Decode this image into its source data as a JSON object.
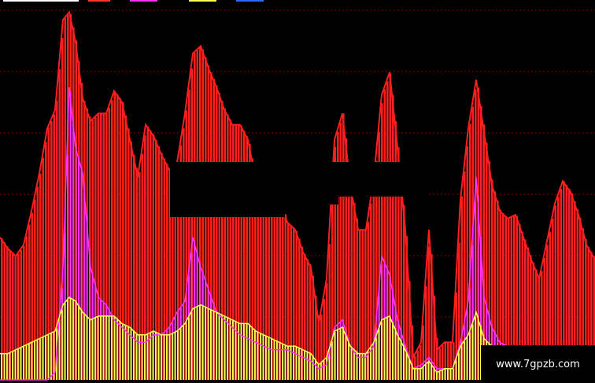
{
  "chart_data": {
    "type": "area",
    "grid": true,
    "legend": "top-left",
    "colors": {
      "background": "#000000",
      "red": "#ff1e1e",
      "magenta": "#ff33ff",
      "yellow": "#ffff55",
      "grid": "#8b0000"
    },
    "x": [
      0,
      10,
      20,
      30,
      40,
      50,
      60,
      70,
      80,
      88,
      96,
      105,
      115,
      125,
      135,
      145,
      155,
      165,
      175,
      185,
      195,
      205,
      215,
      225,
      235,
      245,
      255,
      265,
      275,
      285,
      295,
      305,
      315,
      325,
      335,
      345,
      355,
      365,
      375,
      385,
      395,
      405,
      415,
      425,
      435,
      445,
      455,
      465,
      475,
      485,
      495,
      505,
      515,
      525,
      535,
      545,
      555,
      565,
      575,
      585,
      595,
      605,
      615,
      625,
      635,
      645,
      655,
      665,
      675,
      685,
      695,
      705,
      715,
      725,
      735,
      745,
      756
    ],
    "series": [
      {
        "color": "red",
        "values": [
          0.38,
          0.35,
          0.33,
          0.36,
          0.45,
          0.55,
          0.67,
          0.72,
          0.96,
          0.98,
          0.9,
          0.75,
          0.69,
          0.71,
          0.71,
          0.77,
          0.74,
          0.64,
          0.54,
          0.68,
          0.65,
          0.6,
          0.56,
          0.58,
          0.71,
          0.87,
          0.89,
          0.83,
          0.78,
          0.72,
          0.68,
          0.68,
          0.64,
          0.53,
          0.48,
          0.48,
          0.48,
          0.42,
          0.4,
          0.34,
          0.3,
          0.15,
          0.27,
          0.64,
          0.71,
          0.52,
          0.4,
          0.4,
          0.54,
          0.76,
          0.82,
          0.62,
          0.4,
          0.06,
          0.1,
          0.4,
          0.08,
          0.1,
          0.1,
          0.48,
          0.67,
          0.8,
          0.66,
          0.52,
          0.45,
          0.43,
          0.44,
          0.38,
          0.32,
          0.27,
          0.37,
          0.47,
          0.53,
          0.5,
          0.44,
          0.36,
          0.32
        ]
      },
      {
        "color": "magenta",
        "values": [
          0,
          0,
          0,
          0,
          0,
          0,
          0,
          0.02,
          0.3,
          0.78,
          0.62,
          0.55,
          0.3,
          0.22,
          0.2,
          0.16,
          0.14,
          0.12,
          0.1,
          0.1,
          0.12,
          0.12,
          0.14,
          0.18,
          0.21,
          0.38,
          0.3,
          0.24,
          0.18,
          0.16,
          0.14,
          0.12,
          0.11,
          0.1,
          0.09,
          0.08,
          0.08,
          0.08,
          0.07,
          0.06,
          0.05,
          0.03,
          0.04,
          0.14,
          0.16,
          0.09,
          0.06,
          0.06,
          0.09,
          0.33,
          0.28,
          0.16,
          0.09,
          0.03,
          0.04,
          0.06,
          0.03,
          0.03,
          0.03,
          0.1,
          0.21,
          0.54,
          0.22,
          0.14,
          0.1,
          0.09,
          0.09,
          0.08,
          0.07,
          0.06,
          0.07,
          0.07,
          0.07,
          0.08,
          0.06,
          0.05,
          0.05
        ]
      },
      {
        "color": "yellow",
        "values": [
          0.07,
          0.07,
          0.08,
          0.09,
          0.1,
          0.11,
          0.12,
          0.13,
          0.2,
          0.22,
          0.21,
          0.18,
          0.16,
          0.17,
          0.17,
          0.17,
          0.15,
          0.14,
          0.12,
          0.12,
          0.13,
          0.12,
          0.12,
          0.13,
          0.15,
          0.19,
          0.2,
          0.19,
          0.18,
          0.17,
          0.16,
          0.15,
          0.15,
          0.13,
          0.12,
          0.11,
          0.1,
          0.09,
          0.09,
          0.08,
          0.07,
          0.04,
          0.06,
          0.13,
          0.14,
          0.09,
          0.07,
          0.07,
          0.1,
          0.16,
          0.17,
          0.12,
          0.08,
          0.03,
          0.03,
          0.05,
          0.02,
          0.03,
          0.03,
          0.09,
          0.12,
          0.18,
          0.11,
          0.09,
          0.08,
          0.07,
          0.07,
          0.07,
          0.06,
          0.05,
          0.06,
          0.06,
          0.07,
          0.06,
          0.05,
          0.04,
          0.04
        ]
      }
    ]
  },
  "watermark": {
    "text": "www.7gpzb.com"
  }
}
